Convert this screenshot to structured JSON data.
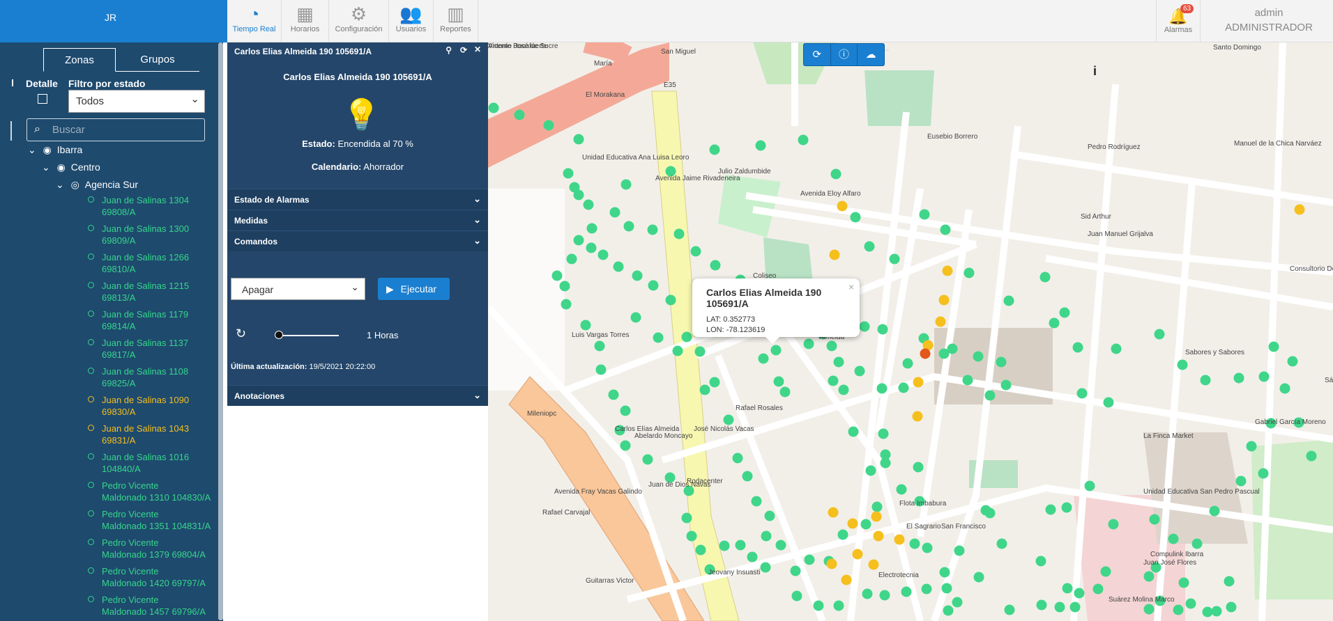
{
  "topbar": {
    "logo_alt": "JR",
    "nav": [
      {
        "label": "Tiempo Real",
        "icon": "speedometer-icon"
      },
      {
        "label": "Horarios",
        "icon": "calendar-icon"
      },
      {
        "label": "Configuración",
        "icon": "gears-icon"
      },
      {
        "label": "Usuarios",
        "icon": "users-icon"
      },
      {
        "label": "Reportes",
        "icon": "bar-chart-icon"
      }
    ],
    "alarm_label": "Alarmas",
    "alarm_count": "63",
    "user_name": "admin",
    "user_role": "ADMINISTRADOR"
  },
  "sidebar": {
    "tab_zonas": "Zonas",
    "tab_grupos": "Grupos",
    "detalle": "Detalle",
    "filtro_label": "Filtro por estado",
    "filtro_value": "Todos",
    "search_placeholder": "Buscar",
    "tree": {
      "root": "Ibarra",
      "zone": "Centro",
      "agency": "Agencia Sur",
      "leaves": [
        {
          "line1": "Juan de Salinas 1304",
          "line2": "69808/A",
          "status": "green"
        },
        {
          "line1": "Juan de Salinas 1300",
          "line2": "69809/A",
          "status": "green"
        },
        {
          "line1": "Juan de Salinas 1266",
          "line2": "69810/A",
          "status": "green"
        },
        {
          "line1": "Juan de Salinas 1215",
          "line2": "69813/A",
          "status": "green"
        },
        {
          "line1": "Juan de Salinas 1179",
          "line2": "69814/A",
          "status": "green"
        },
        {
          "line1": "Juan de Salinas 1137",
          "line2": "69817/A",
          "status": "green"
        },
        {
          "line1": "Juan de Salinas 1108",
          "line2": "69825/A",
          "status": "green"
        },
        {
          "line1": "Juan de Salinas 1090",
          "line2": "69830/A",
          "status": "yellow"
        },
        {
          "line1": "Juan de Salinas 1043",
          "line2": "69831/A",
          "status": "yellow"
        },
        {
          "line1": "Juan de Salinas 1016",
          "line2": "104840/A",
          "status": "green"
        },
        {
          "line1": "Pedro Vicente",
          "line2": "Maldonado 1310 104830/A",
          "status": "green"
        },
        {
          "line1": "Pedro Vicente",
          "line2": "Maldonado 1351 104831/A",
          "status": "green"
        },
        {
          "line1": "Pedro Vicente",
          "line2": "Maldonado 1379 69804/A",
          "status": "green"
        },
        {
          "line1": "Pedro Vicente",
          "line2": "Maldonado 1420 69797/A",
          "status": "green"
        },
        {
          "line1": "Pedro Vicente",
          "line2": "Maldonado 1457 69796/A",
          "status": "green"
        }
      ]
    }
  },
  "panel": {
    "header": "Carlos Elias Almeida 190 105691/A",
    "title": "Carlos Elias Almeida 190 105691/A",
    "estado_label": "Estado:",
    "estado_value": "Encendida al 70 %",
    "calendario_label": "Calendario:",
    "calendario_value": "Ahorrador",
    "sections": [
      "Estado de Alarmas",
      "Medidas",
      "Comandos"
    ],
    "command_value": "Apagar",
    "execute_label": "Ejecutar",
    "hours_label": "1 Horas",
    "updated_label": "Última actualización:",
    "updated_value": "19/5/2021 20:22:00",
    "annotations": "Anotaciones"
  },
  "popup": {
    "title": "Carlos Elias Almeida 190 105691/A",
    "lat": "LAT: 0.352773",
    "lon": "LON: -78.123619"
  },
  "map_labels": [
    {
      "text": "San Miguel"
    },
    {
      "text": "E35"
    },
    {
      "text": "El Morakana"
    },
    {
      "text": "María"
    },
    {
      "text": "Santo Domingo"
    },
    {
      "text": "Eusebio Borrero"
    },
    {
      "text": "Pedro Rodríguez"
    },
    {
      "text": "Avenida Eloy Alfaro"
    },
    {
      "text": "Sid Arthur"
    },
    {
      "text": "Juan Manuel Grijalva"
    },
    {
      "text": "Consultorio Dental A Theet"
    },
    {
      "text": "Coliseo"
    },
    {
      "text": "Mileniopc"
    },
    {
      "text": "Luis Vargas Torres"
    },
    {
      "text": "Carlos Elías Almeida"
    },
    {
      "text": "Juan de Dios Navas"
    },
    {
      "text": "Rodacenter"
    },
    {
      "text": "José Nicolás Vacas"
    },
    {
      "text": "Abelardo Moncayo"
    },
    {
      "text": "Rafael Carvajal"
    },
    {
      "text": "Avenida Fray Vacas Galindo"
    },
    {
      "text": "Guitarras Victor"
    },
    {
      "text": "Jeovany Insuasti"
    },
    {
      "text": "Electrotecnia"
    },
    {
      "text": "Flota Imbabura"
    },
    {
      "text": "El Sagrario"
    },
    {
      "text": "San Francisco"
    },
    {
      "text": "La Finca Market"
    },
    {
      "text": "Unidad Educativa San Pedro Pascual"
    },
    {
      "text": "Gabriel García Moreno"
    },
    {
      "text": "Sabores y Sabores"
    },
    {
      "text": "Compulink Ibarra"
    },
    {
      "text": "Juan José Flores"
    },
    {
      "text": "Suárez Molina Marco"
    },
    {
      "text": "Unidad Educativa Ana Luisa Leoro"
    },
    {
      "text": "Rafael Rosales"
    },
    {
      "text": "Julio Zaldumbide"
    },
    {
      "text": "Avenida Jaime Rivadeneira"
    },
    {
      "text": "Antonio José de Sucre"
    },
    {
      "text": "Almeida"
    },
    {
      "text": "Vicente Rocafuerte"
    },
    {
      "text": "Manuel de la Chica Narváez"
    },
    {
      "text": "Sánchez y Cifuentes"
    }
  ]
}
